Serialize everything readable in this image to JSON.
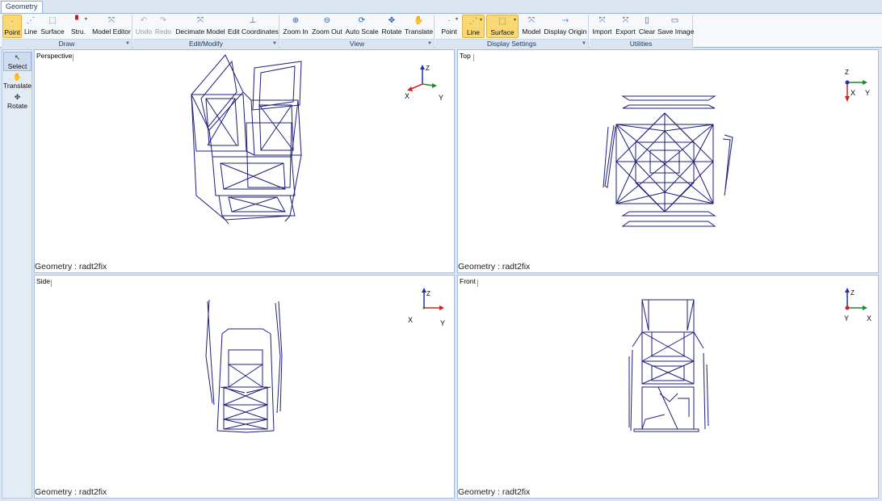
{
  "window": {
    "tab": "Geometry"
  },
  "ribbon": {
    "groups": {
      "draw": "Draw",
      "edit": "Edit/Modify",
      "view": "View",
      "display": "Display Settings",
      "utilities": "Utilities"
    },
    "buttons": {
      "point": "Point",
      "line": "Line",
      "surface": "Surface",
      "stru": "Stru.",
      "model_editor": "Model Editor",
      "undo": "Undo",
      "redo": "Redo",
      "decimate": "Decimate Model",
      "edit_coords": "Edit Coordinates",
      "zoom_in": "Zoom In",
      "zoom_out": "Zoom Out",
      "auto_scale": "Auto Scale",
      "rotate": "Rotate",
      "translate": "Translate",
      "ds_point": "Point",
      "ds_line": "Line",
      "ds_surface": "Surface",
      "ds_model": "Model",
      "display_origin": "Display Origin",
      "import": "Import",
      "export": "Export",
      "clear": "Clear",
      "save_image": "Save Image"
    }
  },
  "tools": {
    "select": "Select",
    "translate": "Translate",
    "rotate": "Rotate"
  },
  "viewports": {
    "perspective": {
      "name": "Perspective",
      "status": "Geometry : radt2fix"
    },
    "top": {
      "name": "Top",
      "status": "Geometry : radt2fix"
    },
    "side": {
      "name": "Side",
      "status": "Geometry : radt2fix"
    },
    "front": {
      "name": "Front",
      "status": "Geometry : radt2fix"
    }
  },
  "axes": {
    "x": "X",
    "y": "Y",
    "z": "Z"
  },
  "colors": {
    "wire": "#1f1f7a",
    "axis_x": "#d42020",
    "axis_y": "#1a8a2a",
    "axis_z": "#2030b0",
    "active": "#fcd874"
  }
}
